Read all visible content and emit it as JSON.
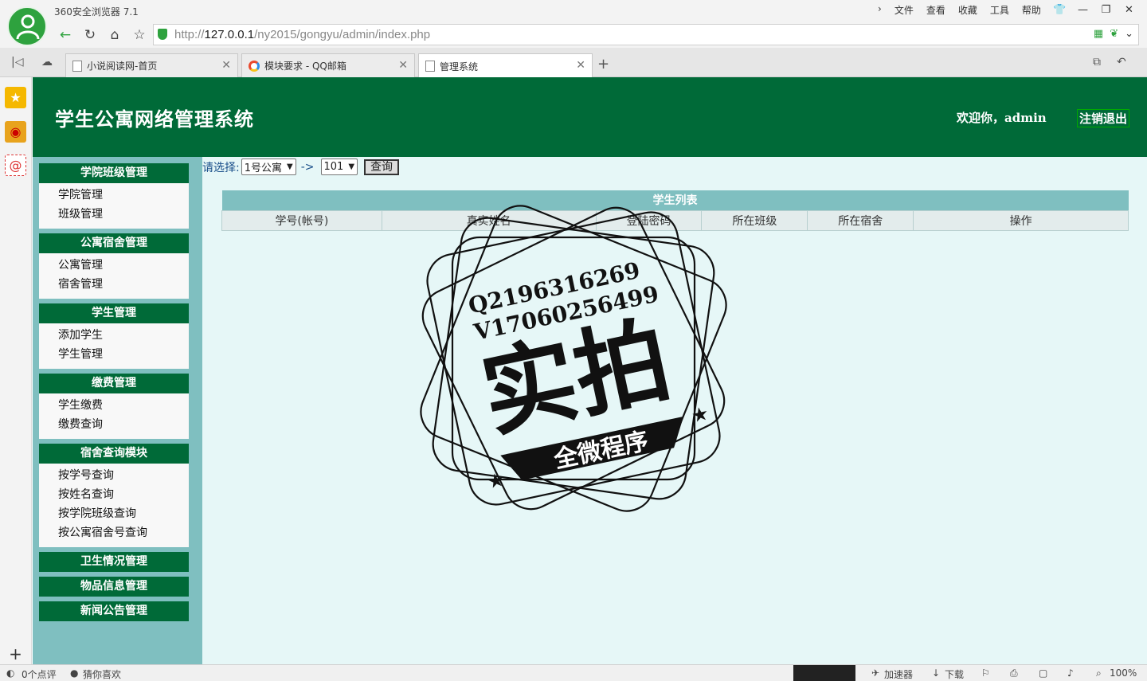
{
  "browser": {
    "name": "360安全浏览器 7.1",
    "menu": [
      "文件",
      "查看",
      "收藏",
      "工具",
      "帮助"
    ],
    "url_host": "127.0.0.1",
    "url_prefix": "http://",
    "url_path": "/ny2015/gongyu/admin/index.php",
    "tabs": [
      {
        "label": "小说阅读网-首页"
      },
      {
        "label": "模块要求 - QQ邮箱"
      },
      {
        "label": "管理系统"
      }
    ]
  },
  "header": {
    "title": "学生公寓网络管理系统",
    "welcome": "欢迎你，admin",
    "logout": "注销退出"
  },
  "sidebar": {
    "groups": [
      {
        "title": "学院班级管理",
        "items": [
          "学院管理",
          "班级管理"
        ]
      },
      {
        "title": "公寓宿舍管理",
        "items": [
          "公寓管理",
          "宿舍管理"
        ]
      },
      {
        "title": "学生管理",
        "items": [
          "添加学生",
          "学生管理"
        ]
      },
      {
        "title": "缴费管理",
        "items": [
          "学生缴费",
          "缴费查询"
        ]
      },
      {
        "title": "宿舍查询模块",
        "items": [
          "按学号查询",
          "按姓名查询",
          "按学院班级查询",
          "按公寓宿舍号查询"
        ]
      },
      {
        "title": "卫生情况管理",
        "items": []
      },
      {
        "title": "物品信息管理",
        "items": []
      },
      {
        "title": "新闻公告管理",
        "items": []
      }
    ]
  },
  "filter": {
    "label": "请选择:",
    "building": "1号公寓",
    "arrow": "->",
    "room": "101",
    "query_button": "查询"
  },
  "table": {
    "caption": "学生列表",
    "columns": [
      "学号(帐号)",
      "真实姓名",
      "登陆密码",
      "所在班级",
      "所在宿舍",
      "操作"
    ]
  },
  "watermark": {
    "line1": "Q2196316269",
    "line2": "V17060256499",
    "big": "实拍",
    "ribbon": "全微程序"
  },
  "status": {
    "comments": "0个点评",
    "guess": "猜你喜欢",
    "accelerator": "加速器",
    "download": "下载",
    "zoom": "100%"
  },
  "colors": {
    "header_green": "#006a38",
    "sidebar_teal": "#7fbfc0",
    "content_bg": "#e6f7f7"
  }
}
